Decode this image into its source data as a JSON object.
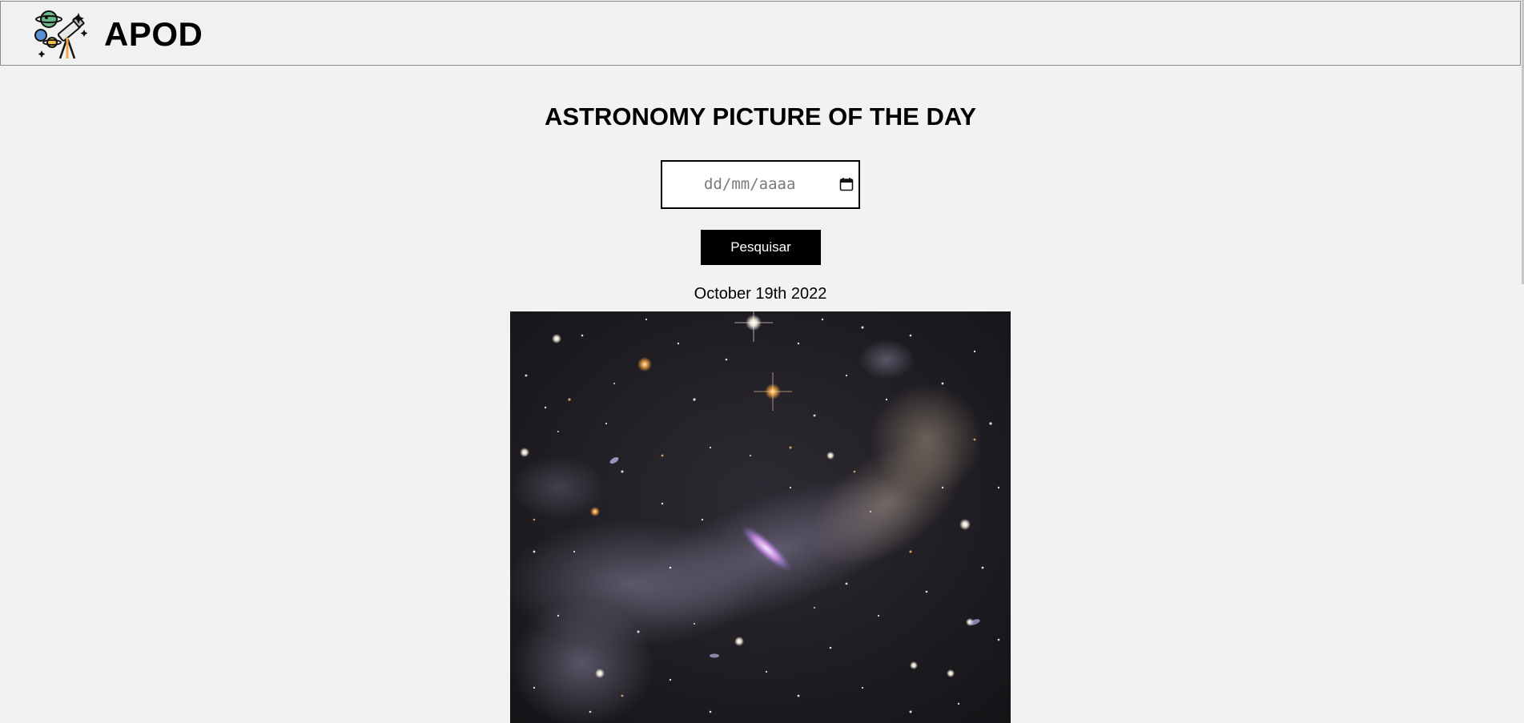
{
  "header": {
    "brand": "APOD",
    "logo_icon": "telescope-planets-icon"
  },
  "main": {
    "title": "ASTRONOMY PICTURE OF THE DAY",
    "date_input": {
      "placeholder": "dd/mm/aaaa",
      "icon": "calendar-icon"
    },
    "search_button_label": "Pesquisar",
    "picture_date": "October 19th 2022",
    "picture_alt": "Galaxy among dusty nebula and stars"
  },
  "colors": {
    "background": "#f2f2f2",
    "button_background": "#000000",
    "button_text": "#ffffff"
  }
}
